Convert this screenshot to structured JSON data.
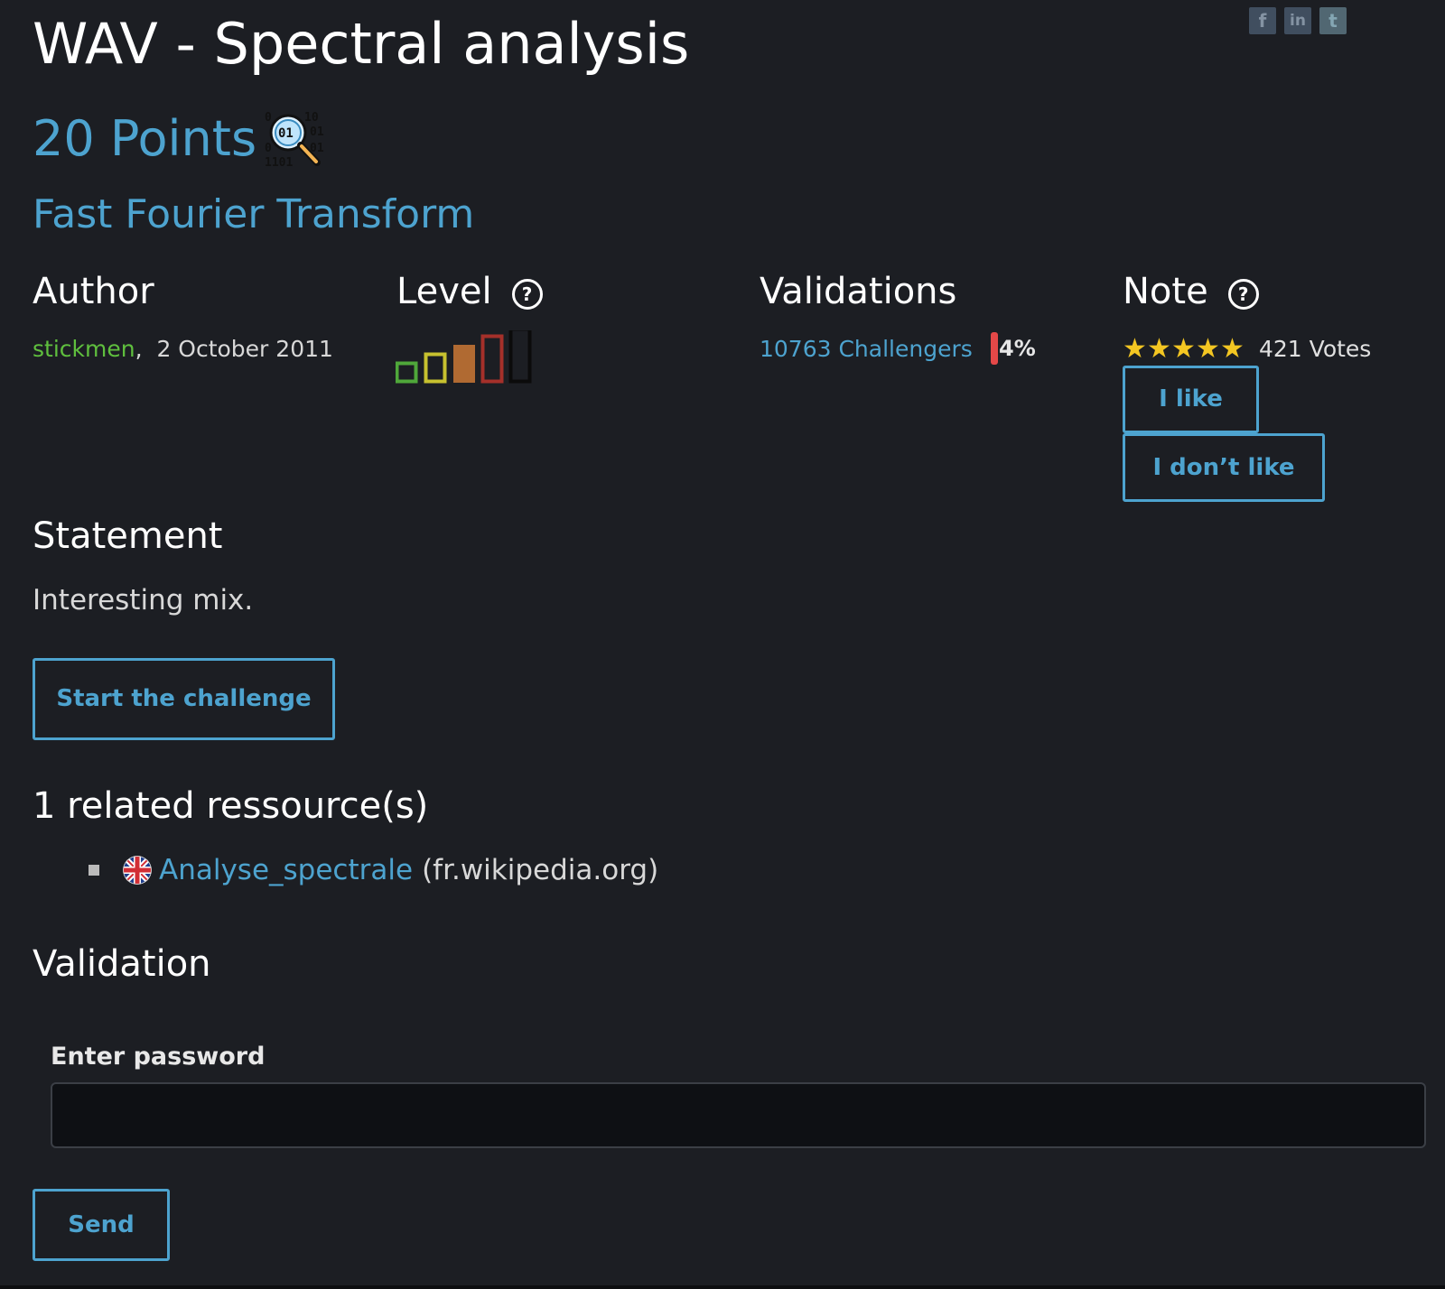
{
  "social": {
    "facebook_glyph": "f",
    "linkedin_glyph": "in",
    "twitter_glyph": "t"
  },
  "challenge": {
    "title": "WAV - Spectral analysis",
    "points": "20 Points",
    "subtitle": "Fast Fourier Transform",
    "category_icon": "binary-magnifier-icon"
  },
  "author": {
    "heading": "Author",
    "name": "stickmen",
    "separator": ",",
    "date": "2 October 2011"
  },
  "level": {
    "heading": "Level",
    "help_glyph": "?",
    "current": 3,
    "max": 5
  },
  "validations": {
    "heading": "Validations",
    "challengers": "10763 Challengers",
    "percent_text": "4%",
    "percent_value": 4,
    "bar_color": "#e44848"
  },
  "note": {
    "heading": "Note",
    "help_glyph": "?",
    "stars": 5,
    "votes": "421 Votes",
    "like_label": "I like",
    "dislike_label": "I don’t like"
  },
  "statement": {
    "heading": "Statement",
    "text": "Interesting mix.",
    "start_label": "Start the challenge"
  },
  "resources": {
    "heading": "1 related ressource(s)",
    "items": [
      {
        "link": "Analyse_spectrale",
        "domain": "(fr.wikipedia.org)",
        "flag_icon": "uk-flag-icon"
      }
    ]
  },
  "validation": {
    "heading": "Validation",
    "password_label": "Enter password",
    "password_value": "",
    "send_label": "Send"
  },
  "colors": {
    "background": "#1c1e23",
    "accent": "#4da3cf",
    "author_green": "#5fbf3e",
    "star": "#f3c622"
  }
}
